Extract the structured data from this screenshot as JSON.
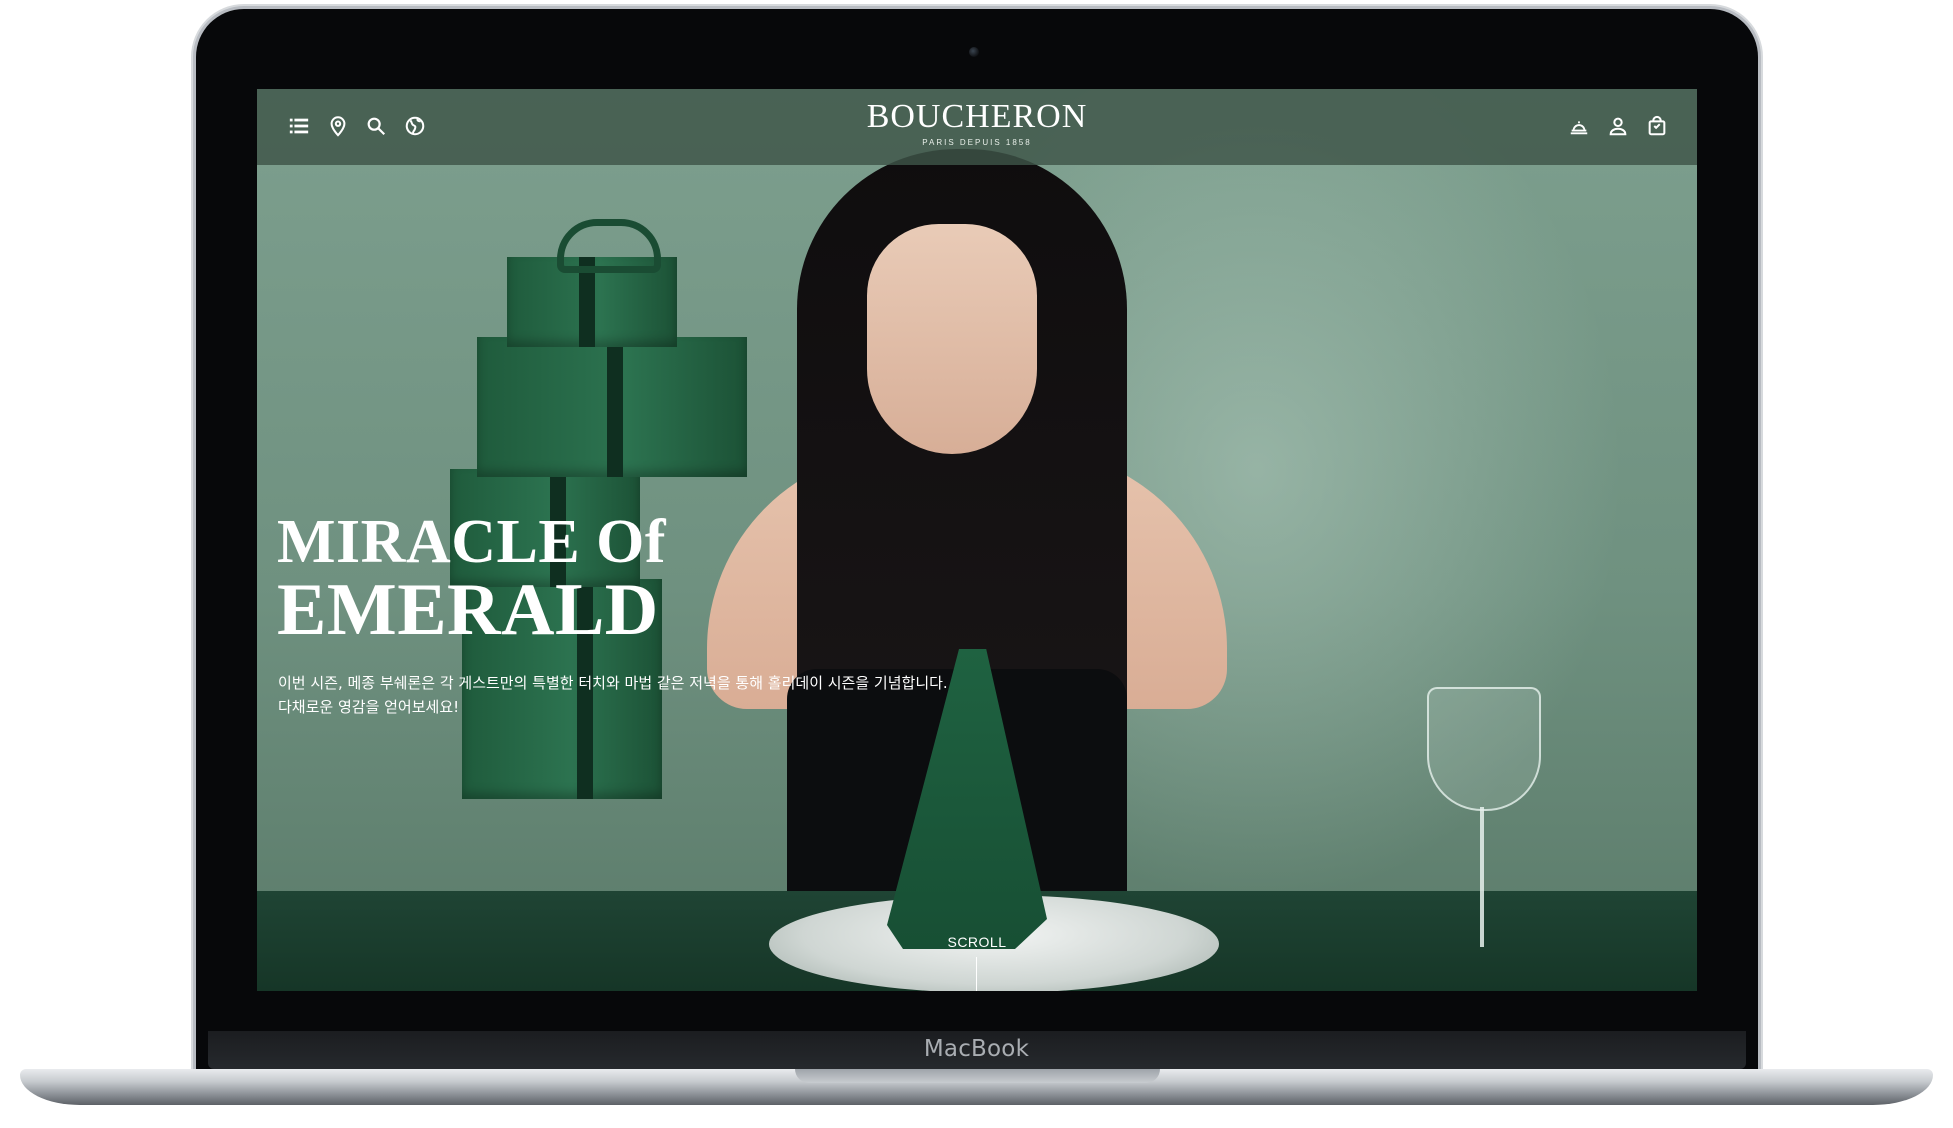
{
  "device": {
    "brand_label": "MacBook"
  },
  "header": {
    "logo": "BOUCHERON",
    "logo_tagline": "PARIS DEPUIS 1858",
    "left_icons": [
      "menu-list-icon",
      "location-pin-icon",
      "search-icon",
      "globe-icon"
    ],
    "right_icons": [
      "appointment-bell-icon",
      "account-icon",
      "shopping-bag-icon"
    ]
  },
  "hero": {
    "title_line1": "MIRACLE Of",
    "title_line2": "EMERALD",
    "description_line1": "이번 시즌, 메종 부쉐론은 각 게스트만의 특별한 터치와 마법 같은 저녁을 통해 홀리데이 시즌을 기념합니다.",
    "description_line2": "다채로운 영감을 얻어보세요!",
    "scroll_label": "SCROLL"
  },
  "colors": {
    "header_bg": "#3e5448",
    "scene_bg": "#6f9180",
    "emerald": "#2c7350",
    "text": "#ffffff"
  }
}
